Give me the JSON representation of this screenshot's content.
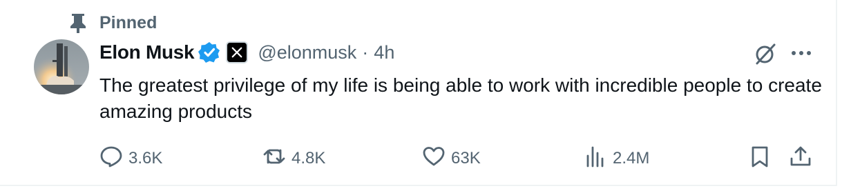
{
  "pinned": {
    "label": "Pinned"
  },
  "author": {
    "name": "Elon Musk",
    "handle": "@elonmusk",
    "separator": "·",
    "time": "4h"
  },
  "tweet": {
    "text": "The greatest privilege of my life is being able to work with incredible people to create amazing products"
  },
  "actions": {
    "replies": "3.6K",
    "reposts": "4.8K",
    "likes": "63K",
    "views": "2.4M"
  },
  "icons": {
    "pin": "pin-icon",
    "verified": "verified-badge-icon",
    "affiliate": "x-logo-icon",
    "grok": "grok-icon",
    "more": "more-icon",
    "reply": "reply-icon",
    "repost": "repost-icon",
    "like": "heart-icon",
    "views": "views-icon",
    "bookmark": "bookmark-icon",
    "share": "share-icon"
  },
  "colors": {
    "text": "#0f1419",
    "secondary": "#536471",
    "verified": "#1d9bf0",
    "border": "#eff3f4"
  }
}
